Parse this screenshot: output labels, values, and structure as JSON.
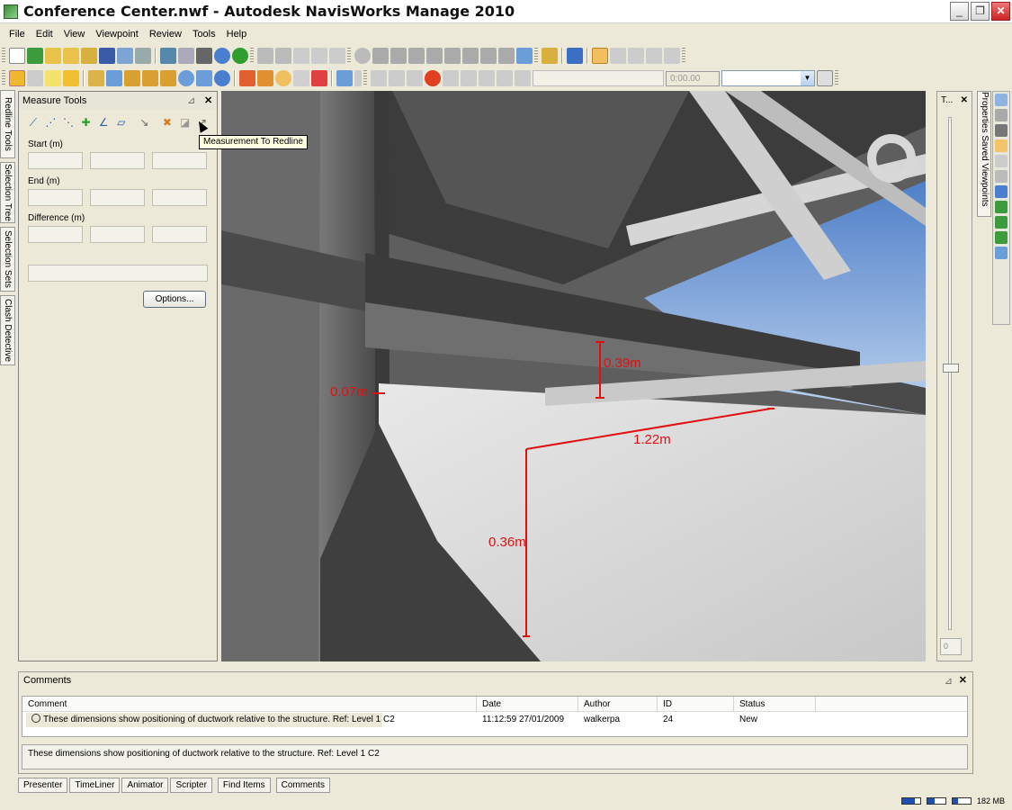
{
  "window": {
    "title": "Conference Center.nwf - Autodesk NavisWorks Manage 2010",
    "controls": [
      "_",
      "❐",
      "✕"
    ]
  },
  "menu": [
    "File",
    "Edit",
    "View",
    "Viewpoint",
    "Review",
    "Tools",
    "Help"
  ],
  "animation": {
    "time_value": "0:00.00"
  },
  "left_tabs": [
    "Redline Tools",
    "Selection Tree",
    "Selection Sets",
    "Clash Detective"
  ],
  "measure_panel": {
    "title": "Measure Tools",
    "start_label": "Start (m)",
    "end_label": "End (m)",
    "difference_label": "Difference (m)",
    "options_button": "Options...",
    "tooltip": "Measurement To Redline",
    "tool_icons": [
      "point-to-point-icon",
      "point-to-multiple-points-icon",
      "point-line-icon",
      "accumulate-icon",
      "angle-icon",
      "area-icon",
      "shortest-distance-icon",
      "clear-icon",
      "measurement-to-redline-icon"
    ]
  },
  "viewport": {
    "measurements": [
      "0.39m",
      "0.07m",
      "1.22m",
      "0.36m"
    ],
    "measure_color": "#e01010"
  },
  "right_panel": {
    "title": "T...",
    "value": "0"
  },
  "right_tabs": {
    "label": "Properties  Saved Viewpoints"
  },
  "comments": {
    "title": "Comments",
    "columns": [
      "Comment",
      "Date",
      "Author",
      "ID",
      "Status"
    ],
    "rows": [
      {
        "comment": "These dimensions show positioning of ductwork relative to the structure. Ref: Level 1 C2",
        "date": "11:12:59 27/01/2009",
        "author": "walkerpa",
        "id": "24",
        "status": "New"
      }
    ],
    "detail": "These dimensions show positioning of ductwork relative to the structure. Ref: Level 1 C2"
  },
  "bottom_tabs": [
    "Presenter",
    "TimeLiner",
    "Animator",
    "Scripter",
    "Find Items",
    "Comments"
  ],
  "status": {
    "memory": "182 MB"
  }
}
